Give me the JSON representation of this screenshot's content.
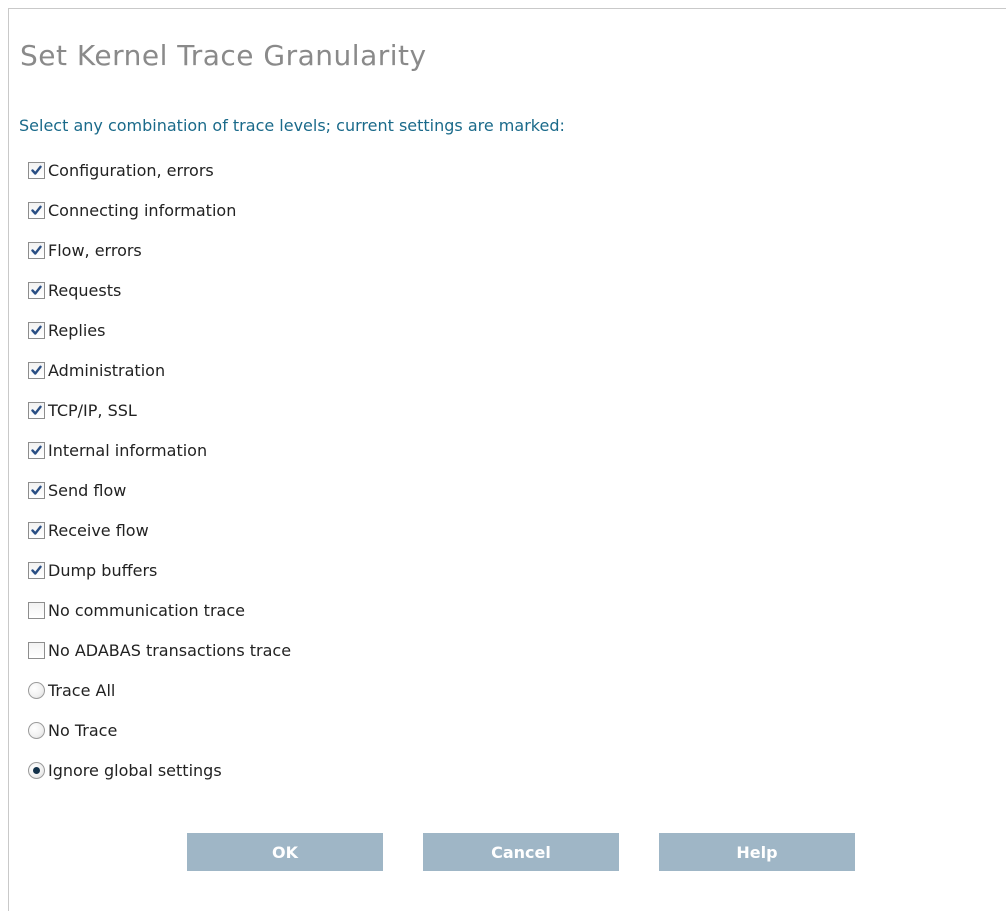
{
  "page": {
    "title": "Set Kernel Trace Granularity",
    "instruction": "Select any combination of trace levels; current settings are marked:"
  },
  "colors": {
    "title_gray": "#8a8a8a",
    "instruction_blue": "#1a6a8a",
    "button_fill": "#9fb6c6",
    "button_text": "#ffffff",
    "checkmark_blue": "#294e84",
    "radio_dot": "#13324a"
  },
  "options": [
    {
      "type": "checkbox",
      "name": "configuration-errors",
      "label": "Configuration, errors",
      "checked": true
    },
    {
      "type": "checkbox",
      "name": "connecting-information",
      "label": "Connecting information",
      "checked": true
    },
    {
      "type": "checkbox",
      "name": "flow-errors",
      "label": "Flow, errors",
      "checked": true
    },
    {
      "type": "checkbox",
      "name": "requests",
      "label": "Requests",
      "checked": true
    },
    {
      "type": "checkbox",
      "name": "replies",
      "label": "Replies",
      "checked": true
    },
    {
      "type": "checkbox",
      "name": "administration",
      "label": "Administration",
      "checked": true
    },
    {
      "type": "checkbox",
      "name": "tcp-ip-ssl",
      "label": "TCP/IP, SSL",
      "checked": true
    },
    {
      "type": "checkbox",
      "name": "internal-information",
      "label": "Internal information",
      "checked": true
    },
    {
      "type": "checkbox",
      "name": "send-flow",
      "label": "Send flow",
      "checked": true
    },
    {
      "type": "checkbox",
      "name": "receive-flow",
      "label": "Receive flow",
      "checked": true
    },
    {
      "type": "checkbox",
      "name": "dump-buffers",
      "label": "Dump buffers",
      "checked": true
    },
    {
      "type": "checkbox",
      "name": "no-communication-trace",
      "label": "No communication trace",
      "checked": false
    },
    {
      "type": "checkbox",
      "name": "no-adabas-transactions-trace",
      "label": "No ADABAS transactions trace",
      "checked": false
    },
    {
      "type": "radio",
      "name": "trace-all",
      "label": "Trace All",
      "checked": false
    },
    {
      "type": "radio",
      "name": "no-trace",
      "label": "No Trace",
      "checked": false
    },
    {
      "type": "radio",
      "name": "ignore-global-settings",
      "label": "Ignore global settings",
      "checked": true
    }
  ],
  "buttons": {
    "ok": "OK",
    "cancel": "Cancel",
    "help": "Help"
  }
}
